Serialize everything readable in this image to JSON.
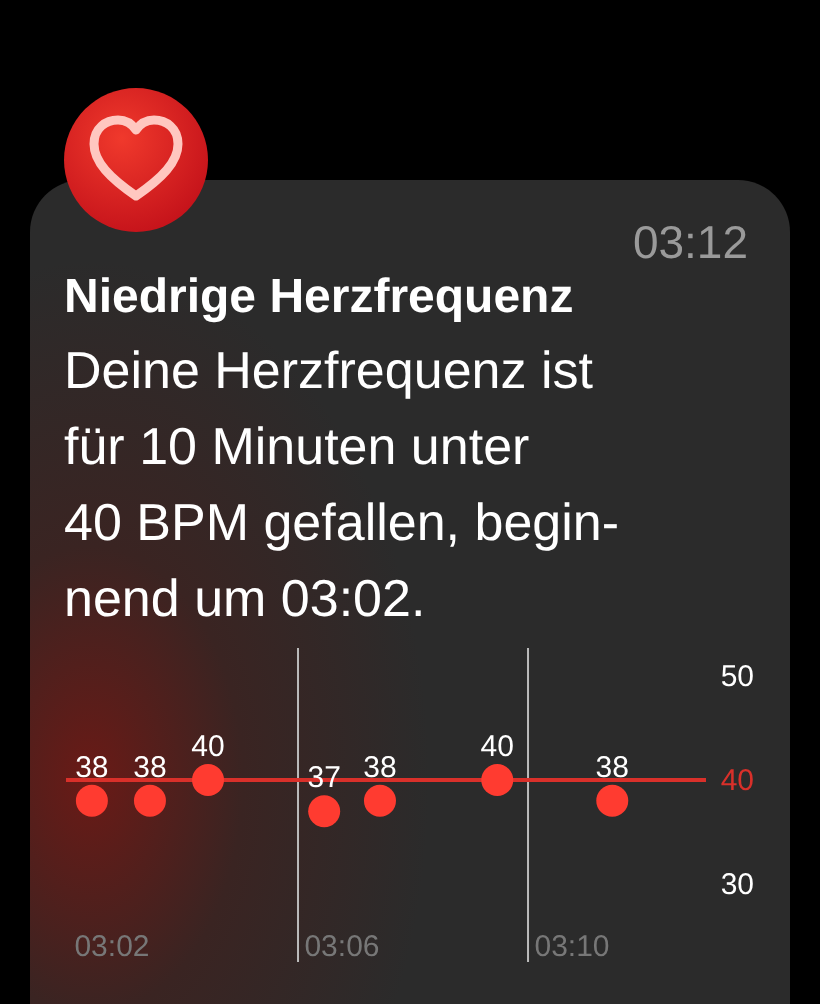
{
  "notification": {
    "time": "03:12",
    "title": "Niedrige Herzfrequenz",
    "message": "Deine Herzfrequenz ist\nfür 10 Minuten unter\n40 BPM gefallen, begin-\nnend um 03:02.",
    "chart_data": {
      "type": "scatter",
      "x": [
        181.65,
        182.66,
        183.67,
        185.69,
        186.66,
        188.7,
        190.7
      ],
      "series": [
        {
          "color": "#ff3b30",
          "values": [
            38,
            38,
            40,
            37,
            38,
            40,
            38
          ]
        }
      ],
      "data_labels": true,
      "ylim": [
        30,
        50
      ],
      "xlim": [
        181.2,
        192.33
      ],
      "yticks": [
        50,
        40,
        30
      ],
      "xticks": [
        {
          "value": 182,
          "label": "03:02"
        },
        {
          "value": 186,
          "label": "03:06"
        },
        {
          "value": 190,
          "label": "03:10"
        }
      ],
      "ref_lines": [
        {
          "axis": "y",
          "value": 40
        }
      ]
    }
  }
}
